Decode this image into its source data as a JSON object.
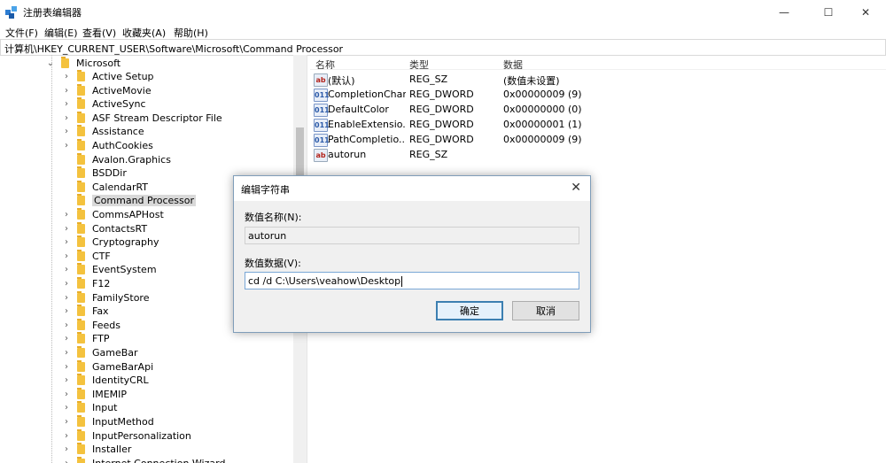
{
  "window": {
    "title": "注册表编辑器",
    "controls": {
      "minimize": "—",
      "maximize": "☐",
      "close": "✕"
    }
  },
  "menu": [
    "文件(F)",
    "编辑(E)",
    "查看(V)",
    "收藏夹(A)",
    "帮助(H)"
  ],
  "address": "计算机\\HKEY_CURRENT_USER\\Software\\Microsoft\\Command Processor",
  "tree": {
    "parent": "Microsoft",
    "selected": "Command Processor",
    "items": [
      {
        "label": "Active Setup",
        "expandable": true
      },
      {
        "label": "ActiveMovie",
        "expandable": true
      },
      {
        "label": "ActiveSync",
        "expandable": true
      },
      {
        "label": "ASF Stream Descriptor File",
        "expandable": true
      },
      {
        "label": "Assistance",
        "expandable": true
      },
      {
        "label": "AuthCookies",
        "expandable": true
      },
      {
        "label": "Avalon.Graphics",
        "expandable": false
      },
      {
        "label": "BSDDir",
        "expandable": false
      },
      {
        "label": "CalendarRT",
        "expandable": false
      },
      {
        "label": "Command Processor",
        "expandable": false
      },
      {
        "label": "CommsAPHost",
        "expandable": true
      },
      {
        "label": "ContactsRT",
        "expandable": true
      },
      {
        "label": "Cryptography",
        "expandable": true
      },
      {
        "label": "CTF",
        "expandable": true
      },
      {
        "label": "EventSystem",
        "expandable": true
      },
      {
        "label": "F12",
        "expandable": true
      },
      {
        "label": "FamilyStore",
        "expandable": true
      },
      {
        "label": "Fax",
        "expandable": true
      },
      {
        "label": "Feeds",
        "expandable": true
      },
      {
        "label": "FTP",
        "expandable": true
      },
      {
        "label": "GameBar",
        "expandable": true
      },
      {
        "label": "GameBarApi",
        "expandable": true
      },
      {
        "label": "IdentityCRL",
        "expandable": true
      },
      {
        "label": "IMEMIP",
        "expandable": true
      },
      {
        "label": "Input",
        "expandable": true
      },
      {
        "label": "InputMethod",
        "expandable": true
      },
      {
        "label": "InputPersonalization",
        "expandable": true
      },
      {
        "label": "Installer",
        "expandable": true
      },
      {
        "label": "Internet Connection Wizard",
        "expandable": true
      }
    ]
  },
  "values": {
    "headers": {
      "name": "名称",
      "type": "类型",
      "data": "数据"
    },
    "rows": [
      {
        "icon": "ab",
        "name": "(默认)",
        "type": "REG_SZ",
        "data": "(数值未设置)"
      },
      {
        "icon": "011",
        "name": "CompletionChar",
        "type": "REG_DWORD",
        "data": "0x00000009 (9)"
      },
      {
        "icon": "011",
        "name": "DefaultColor",
        "type": "REG_DWORD",
        "data": "0x00000000 (0)"
      },
      {
        "icon": "011",
        "name": "EnableExtensio...",
        "type": "REG_DWORD",
        "data": "0x00000001 (1)"
      },
      {
        "icon": "011",
        "name": "PathCompletio...",
        "type": "REG_DWORD",
        "data": "0x00000009 (9)"
      },
      {
        "icon": "ab",
        "name": "autorun",
        "type": "REG_SZ",
        "data": ""
      }
    ]
  },
  "dialog": {
    "title": "编辑字符串",
    "close": "✕",
    "name_label": "数值名称(N):",
    "name_value": "autorun",
    "data_label": "数值数据(V):",
    "data_value": "cd /d C:\\Users\\veahow\\Desktop",
    "ok": "确定",
    "cancel": "取消"
  }
}
